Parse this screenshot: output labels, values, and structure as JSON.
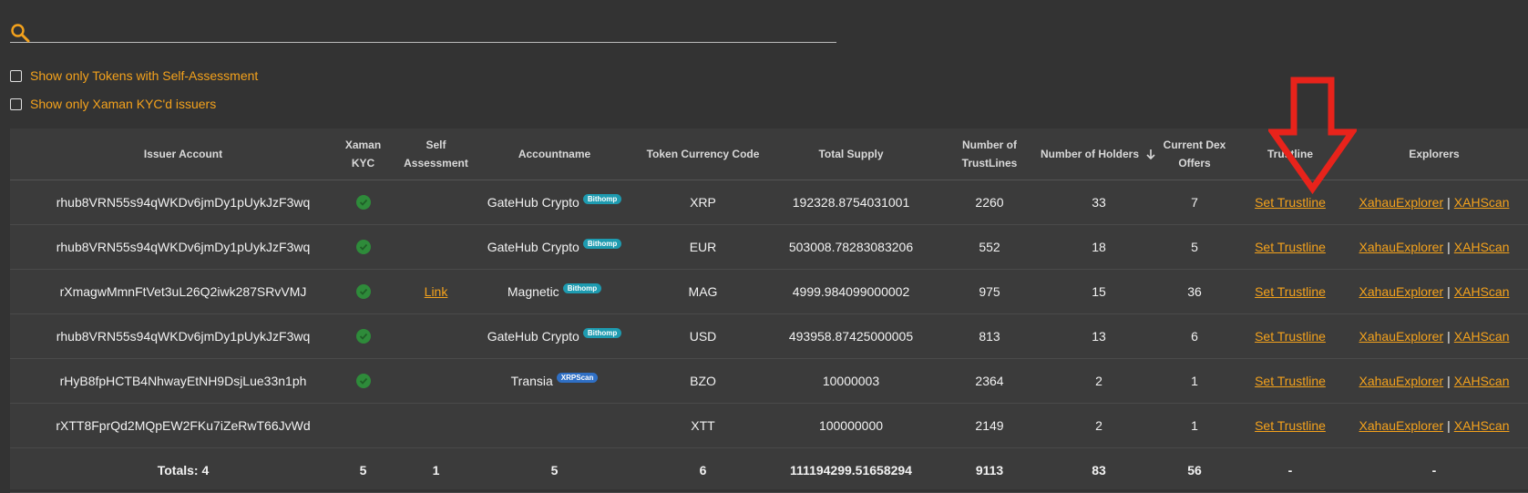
{
  "search": {
    "placeholder": "",
    "value": ""
  },
  "filters": [
    {
      "label": "Show only Tokens with Self-Assessment",
      "checked": false
    },
    {
      "label": "Show only Xaman KYC'd issuers",
      "checked": false
    }
  ],
  "table": {
    "headers": {
      "issuer": "Issuer Account",
      "kyc": "Xaman KYC",
      "self": "Self Assessment",
      "accountname": "Accountname",
      "currency": "Token Currency Code",
      "supply": "Total Supply",
      "trustlines": "Number of TrustLines",
      "holders": "Number of Holders",
      "offers": "Current Dex Offers",
      "trustline": "Trustline",
      "explorers": "Explorers"
    },
    "sort_icon": "arrow-down-icon",
    "rows": [
      {
        "issuer": "rhub8VRN55s94qWKDv6jmDy1pUykJzF3wq",
        "kyc": true,
        "self": "",
        "accountname": "GateHub Crypto",
        "badge": "Bithomp",
        "currency": "XRP",
        "supply": "192328.8754031001",
        "trustlines": "2260",
        "holders": "33",
        "offers": "7",
        "trustline": "Set Trustline",
        "explorer1": "XahauExplorer",
        "explorer2": "XAHScan"
      },
      {
        "issuer": "rhub8VRN55s94qWKDv6jmDy1pUykJzF3wq",
        "kyc": true,
        "self": "",
        "accountname": "GateHub Crypto",
        "badge": "Bithomp",
        "currency": "EUR",
        "supply": "503008.78283083206",
        "trustlines": "552",
        "holders": "18",
        "offers": "5",
        "trustline": "Set Trustline",
        "explorer1": "XahauExplorer",
        "explorer2": "XAHScan"
      },
      {
        "issuer": "rXmagwMmnFtVet3uL26Q2iwk287SRvVMJ",
        "kyc": true,
        "self": "Link",
        "accountname": "Magnetic",
        "badge": "Bithomp",
        "currency": "MAG",
        "supply": "4999.984099000002",
        "trustlines": "975",
        "holders": "15",
        "offers": "36",
        "trustline": "Set Trustline",
        "explorer1": "XahauExplorer",
        "explorer2": "XAHScan"
      },
      {
        "issuer": "rhub8VRN55s94qWKDv6jmDy1pUykJzF3wq",
        "kyc": true,
        "self": "",
        "accountname": "GateHub Crypto",
        "badge": "Bithomp",
        "currency": "USD",
        "supply": "493958.87425000005",
        "trustlines": "813",
        "holders": "13",
        "offers": "6",
        "trustline": "Set Trustline",
        "explorer1": "XahauExplorer",
        "explorer2": "XAHScan"
      },
      {
        "issuer": "rHyB8fpHCTB4NhwayEtNH9DsjLue33n1ph",
        "kyc": true,
        "self": "",
        "accountname": "Transia",
        "badge": "XRPScan",
        "currency": "BZO",
        "supply": "10000003",
        "trustlines": "2364",
        "holders": "2",
        "offers": "1",
        "trustline": "Set Trustline",
        "explorer1": "XahauExplorer",
        "explorer2": "XAHScan"
      },
      {
        "issuer": "rXTT8FprQd2MQpEW2FKu7iZeRwT66JvWd",
        "kyc": false,
        "self": "",
        "accountname": "",
        "badge": "",
        "currency": "XTT",
        "supply": "100000000",
        "trustlines": "2149",
        "holders": "2",
        "offers": "1",
        "trustline": "Set Trustline",
        "explorer1": "XahauExplorer",
        "explorer2": "XAHScan"
      }
    ],
    "totals": {
      "issuer": "Totals: 4",
      "kyc": "5",
      "self": "1",
      "accountname": "5",
      "currency": "6",
      "supply": "111194299.51658294",
      "trustlines": "9113",
      "holders": "83",
      "offers": "56",
      "trustline": "-",
      "explorers": "-"
    }
  },
  "colors": {
    "background": "#333333",
    "table_background": "#3b3b3b",
    "accent": "#f4a21c",
    "check_green": "#2e8b3a",
    "badge_bithomp": "#1e9bb0",
    "badge_xrpscan": "#2f6fc4",
    "annotation_arrow": "#e8231b"
  },
  "annotation": {
    "icon": "red-down-arrow-icon",
    "points_to": "Trustline"
  }
}
